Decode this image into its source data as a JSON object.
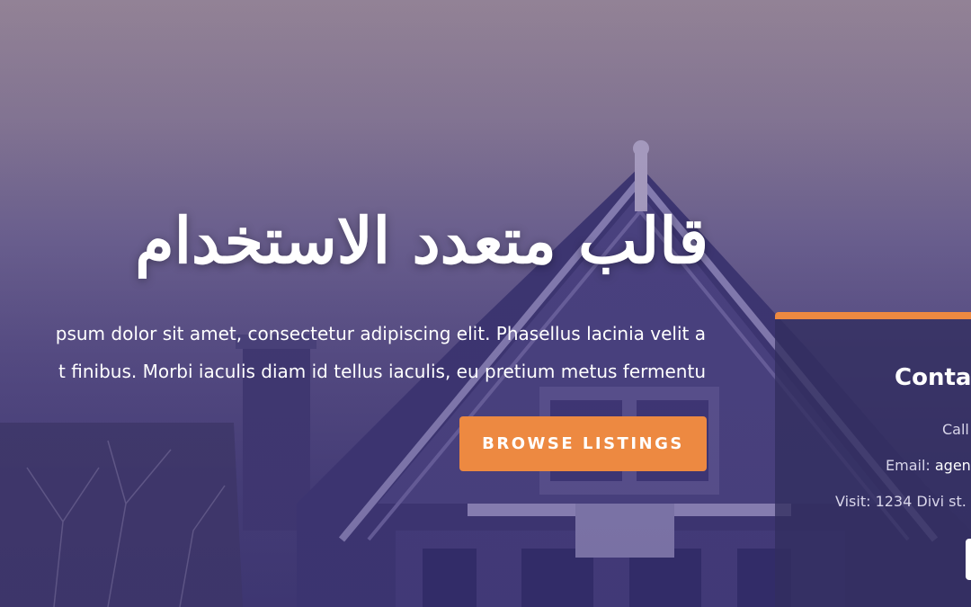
{
  "hero": {
    "title": "قالب متعدد الاستخدام",
    "description_line1": "psum dolor sit amet, consectetur adipiscing elit. Phasellus lacinia velit a",
    "description_line2": "t finibus. Morbi iaculis diam id tellus iaculis, eu pretium metus fermentu",
    "browse_button_label": "BROWSE LISTINGS"
  },
  "contact": {
    "title": "!Conta",
    "call_label": "Call",
    "email_label": "Email: ",
    "email_value": "agen",
    "visit_label": "Visit: 1234 Divi st."
  },
  "colors": {
    "accent": "#ed8941",
    "card_bg": "#322e5f",
    "text": "#ffffff"
  }
}
